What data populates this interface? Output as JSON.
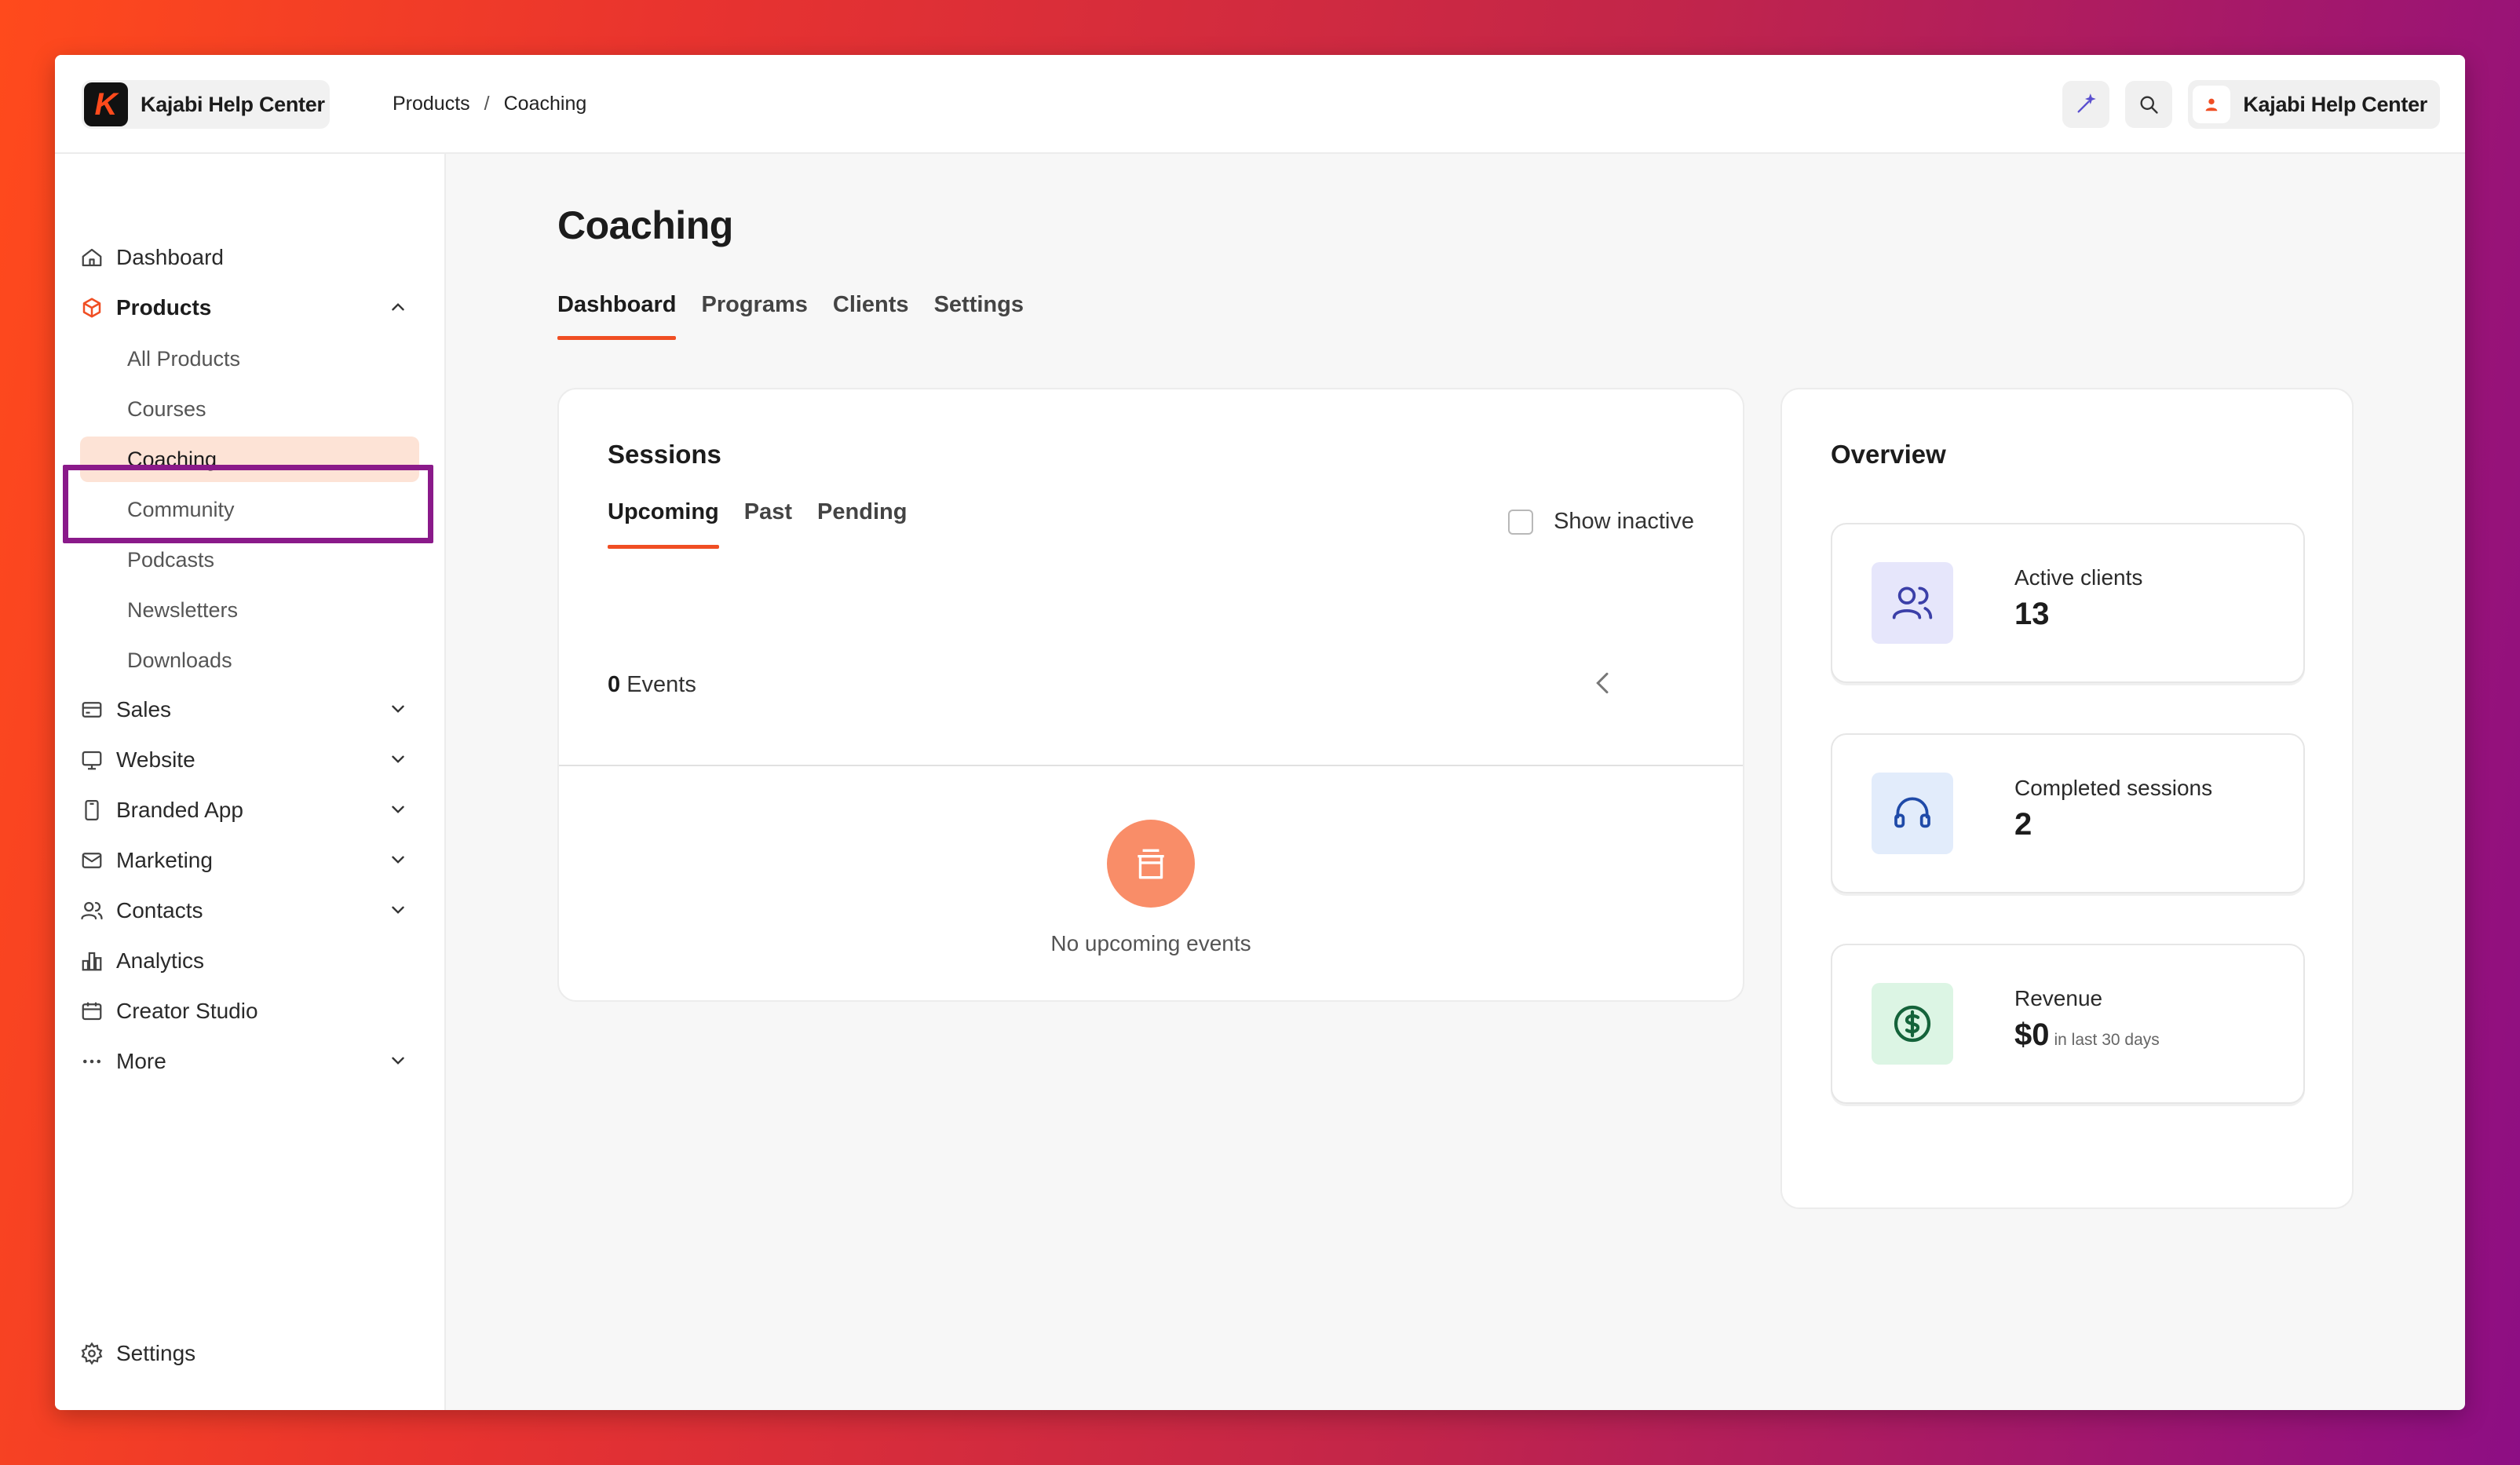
{
  "topbar": {
    "brand_logo_letter": "K",
    "brand_name": "Kajabi Help Center",
    "breadcrumb": [
      "Products",
      "Coaching"
    ],
    "breadcrumb_separator": "/",
    "account_name": "Kajabi Help Center"
  },
  "sidebar": {
    "items": [
      {
        "label": "Dashboard",
        "icon": "home-icon"
      },
      {
        "label": "Products",
        "icon": "box-icon",
        "expanded": true
      },
      {
        "label": "Sales",
        "icon": "card-icon"
      },
      {
        "label": "Website",
        "icon": "monitor-icon"
      },
      {
        "label": "Branded App",
        "icon": "phone-icon"
      },
      {
        "label": "Marketing",
        "icon": "mail-icon"
      },
      {
        "label": "Contacts",
        "icon": "users-icon"
      },
      {
        "label": "Analytics",
        "icon": "bar-chart-icon"
      },
      {
        "label": "Creator Studio",
        "icon": "calendar-icon"
      },
      {
        "label": "More",
        "icon": "more-icon"
      },
      {
        "label": "Settings",
        "icon": "gear-icon"
      }
    ],
    "product_sub_items": [
      "All Products",
      "Courses",
      "Coaching",
      "Community",
      "Podcasts",
      "Newsletters",
      "Downloads"
    ],
    "active_sub_item": "Coaching"
  },
  "main": {
    "title": "Coaching",
    "tabs": [
      "Dashboard",
      "Programs",
      "Clients",
      "Settings"
    ],
    "active_tab": "Dashboard"
  },
  "sessions": {
    "title": "Sessions",
    "tabs": [
      "Upcoming",
      "Past",
      "Pending"
    ],
    "active_tab": "Upcoming",
    "show_inactive_label": "Show inactive",
    "show_inactive_checked": false,
    "events_count": "0",
    "events_label": "Events",
    "empty_text": "No upcoming events"
  },
  "overview": {
    "title": "Overview",
    "stats": [
      {
        "label": "Active clients",
        "value": "13",
        "icon": "users-icon",
        "color": "#e6e6fb"
      },
      {
        "label": "Completed sessions",
        "value": "2",
        "icon": "headset-icon",
        "color": "#e2ecfb"
      },
      {
        "label": "Revenue",
        "value": "$0",
        "suffix": "in last 30 days",
        "icon": "dollar-icon",
        "color": "#dcf5e4"
      }
    ]
  },
  "colors": {
    "accent": "#f04e23",
    "highlight_box": "#8a1a8a",
    "active_nav_bg": "#fde3d6"
  }
}
